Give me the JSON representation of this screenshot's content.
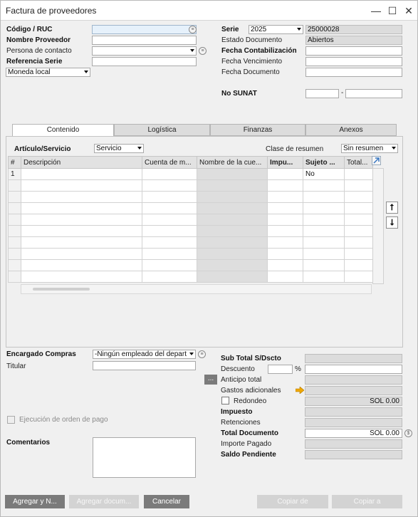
{
  "window": {
    "title": "Factura de proveedores",
    "controls": {
      "minimize": "—",
      "maximize": "☐",
      "close": "✕"
    }
  },
  "header_left": {
    "codigo_label": "Código / RUC",
    "codigo_value": "",
    "nombre_label": "Nombre Proveedor",
    "nombre_value": "",
    "contacto_label": "Persona de contacto",
    "contacto_value": "",
    "referencia_label": "Referencia Serie",
    "referencia_value": "",
    "moneda_value": "Moneda local"
  },
  "header_right": {
    "serie_label": "Serie",
    "serie_select": "2025",
    "serie_number": "25000028",
    "estado_label": "Estado Documento",
    "estado_value": "Abiertos",
    "contab_label": "Fecha Contabilización",
    "venc_label": "Fecha Vencimiento",
    "doc_label": "Fecha Documento",
    "sunat_label": "No SUNAT",
    "sunat_sep": "-"
  },
  "tabs": [
    {
      "label": "Contenido",
      "active": true
    },
    {
      "label": "Logística",
      "active": false
    },
    {
      "label": "Finanzas",
      "active": false
    },
    {
      "label": "Anexos",
      "active": false
    }
  ],
  "contenido": {
    "tipo_label": "Artículo/Servicio",
    "tipo_value": "Servicio",
    "resumen_label": "Clase de resumen",
    "resumen_value": "Sin resumen",
    "columns": [
      "#",
      "Descripción",
      "Cuenta de m...",
      "Nombre de la cue...",
      "Impu...",
      "Sujeto ...",
      "Total..."
    ],
    "rows": [
      {
        "num": "1",
        "descripcion": "",
        "cuenta": "",
        "nombre": "",
        "impuesto": "",
        "sujeto": "No",
        "total": ""
      },
      {
        "num": "",
        "descripcion": "",
        "cuenta": "",
        "nombre": "",
        "impuesto": "",
        "sujeto": "",
        "total": ""
      },
      {
        "num": "",
        "descripcion": "",
        "cuenta": "",
        "nombre": "",
        "impuesto": "",
        "sujeto": "",
        "total": ""
      },
      {
        "num": "",
        "descripcion": "",
        "cuenta": "",
        "nombre": "",
        "impuesto": "",
        "sujeto": "",
        "total": ""
      },
      {
        "num": "",
        "descripcion": "",
        "cuenta": "",
        "nombre": "",
        "impuesto": "",
        "sujeto": "",
        "total": ""
      },
      {
        "num": "",
        "descripcion": "",
        "cuenta": "",
        "nombre": "",
        "impuesto": "",
        "sujeto": "",
        "total": ""
      },
      {
        "num": "",
        "descripcion": "",
        "cuenta": "",
        "nombre": "",
        "impuesto": "",
        "sujeto": "",
        "total": ""
      },
      {
        "num": "",
        "descripcion": "",
        "cuenta": "",
        "nombre": "",
        "impuesto": "",
        "sujeto": "",
        "total": ""
      },
      {
        "num": "",
        "descripcion": "",
        "cuenta": "",
        "nombre": "",
        "impuesto": "",
        "sujeto": "",
        "total": ""
      },
      {
        "num": "",
        "descripcion": "",
        "cuenta": "",
        "nombre": "",
        "impuesto": "",
        "sujeto": "",
        "total": ""
      }
    ],
    "move_up_glyph": "⭡",
    "move_down_glyph": "⭣"
  },
  "footer_left": {
    "encargado_label": "Encargado Compras",
    "encargado_value": "-Ningún empleado del depart",
    "titular_label": "Titular",
    "ejecucion_label": "Ejecución de orden de pago",
    "comentarios_label": "Comentarios"
  },
  "totals": {
    "subtotal_label": "Sub Total S/Dscto",
    "descuento_label": "Descuento",
    "pct": "%",
    "anticipo_label": "Anticipo total",
    "gastos_label": "Gastos adicionales",
    "redondeo_label": "Redondeo",
    "redondeo_value": "SOL 0.00",
    "impuesto_label": "Impuesto",
    "retenciones_label": "Retenciones",
    "total_label": "Total Documento",
    "total_value": "SOL 0.00",
    "importe_label": "Importe Pagado",
    "saldo_label": "Saldo Pendiente",
    "ellipsis": "..."
  },
  "buttons": {
    "agregar": "Agregar y N...",
    "agregar_doc": "Agregar docum...",
    "cancelar": "Cancelar",
    "copiar_de": "Copiar de",
    "copiar_a": "Copiar a"
  },
  "colors": {
    "accent_blue": "#e6f1fb",
    "gold_arrow": "#f0a800",
    "button_dark": "#7b7b7b"
  }
}
